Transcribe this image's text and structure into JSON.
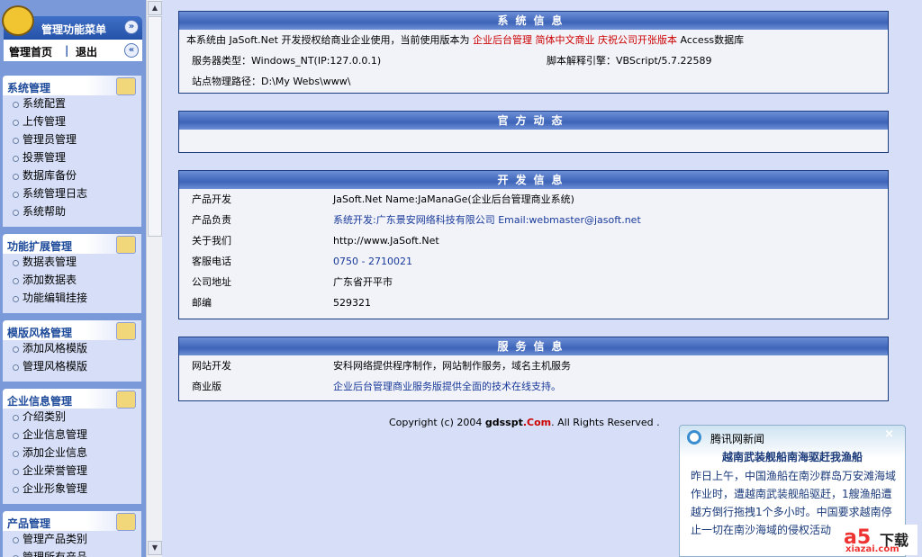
{
  "sidebar": {
    "title": "管理功能菜单",
    "home": "管理首页",
    "sep": "|",
    "logout": "退出",
    "groups": [
      {
        "title": "系统管理",
        "items": [
          "系统配置",
          "上传管理",
          "管理员管理",
          "投票管理",
          "数据库备份",
          "系统管理日志",
          "系统帮助"
        ]
      },
      {
        "title": "功能扩展管理",
        "items": [
          "数据表管理",
          "添加数据表",
          "功能编辑挂接"
        ]
      },
      {
        "title": "模版风格管理",
        "items": [
          "添加风格模版",
          "管理风格模版"
        ]
      },
      {
        "title": "企业信息管理",
        "items": [
          "介绍类别",
          "企业信息管理",
          "添加企业信息",
          "企业荣誉管理",
          "企业形象管理"
        ]
      },
      {
        "title": "产品管理",
        "items": [
          "管理产品类别",
          "管理所有产品"
        ]
      }
    ]
  },
  "sysinfo": {
    "title": "系统信息",
    "line1_prefix": "本系统由 JaSoft.Net 开发授权给商业企业使用，当前使用版本为",
    "version": "企业后台管理 简体中文商业 庆祝公司开张版本",
    "db": "Access数据库",
    "server": "服务器类型：Windows_NT(IP:127.0.0.1)",
    "engine": "脚本解释引擎：VBScript/5.7.22589",
    "path": "站点物理路径：D:\\My Webs\\www\\"
  },
  "news": {
    "title": "官方动态"
  },
  "dev": {
    "title": "开发信息",
    "rows": [
      {
        "k": "产品开发",
        "v": "JaSoft.Net Name:JaManaGe(企业后台管理商业系统)"
      },
      {
        "k": "产品负责",
        "v": "系统开发:广东景安网络科技有限公司 Email:webmaster@jasoft.net"
      },
      {
        "k": "关于我们",
        "v": "http://www.JaSoft.Net"
      },
      {
        "k": "客服电话",
        "v": "0750 - 2710021"
      },
      {
        "k": "公司地址",
        "v": "广东省开平市"
      },
      {
        "k": "邮编",
        "v": "529321"
      }
    ]
  },
  "service": {
    "title": "服务信息",
    "rows": [
      {
        "k": "网站开发",
        "v": "安科网络提供程序制作，网站制作服务，域名主机服务"
      },
      {
        "k": "商业版",
        "v": "企业后台管理商业服务版提供全面的技术在线支持。"
      }
    ]
  },
  "copyright": {
    "pre": "Copyright (c) 2004 ",
    "site": "gdsspt",
    "com": ".Com",
    "post": ". All Rights Reserved ."
  },
  "popup": {
    "source": "腾讯网新闻",
    "close": "×",
    "headline": "越南武装舰船南海驱赶我渔船",
    "body": "昨日上午，中国渔船在南沙群岛万安滩海域作业时，遭越南武装舰船驱赶，1艘渔船遭越方倒行拖拽1个多小时。中国要求越南停止一切在南沙海域的侵权活动"
  },
  "watermark": {
    "a": "a5",
    "b": "下载",
    "c": "xiazai.com"
  }
}
